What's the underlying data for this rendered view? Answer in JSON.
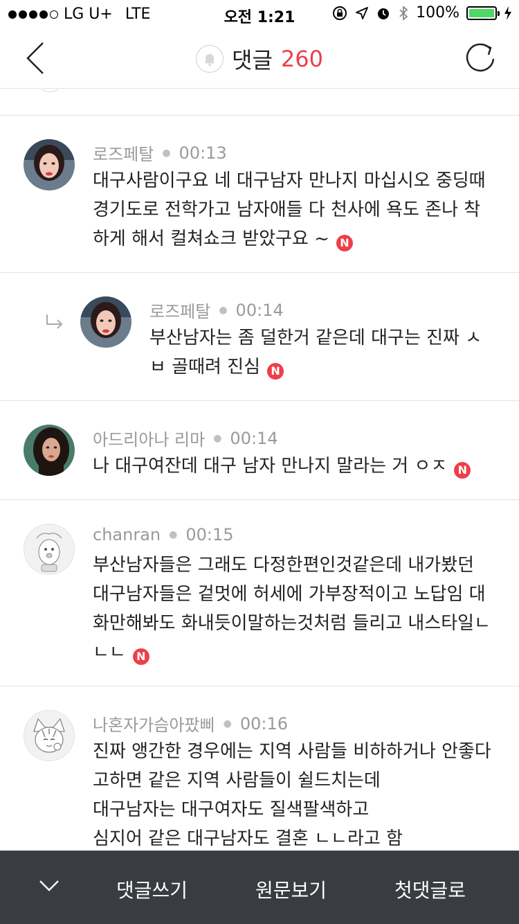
{
  "status": {
    "carrier": "LG U+",
    "network": "LTE",
    "time": "오전 1:21",
    "battery": "100%",
    "battery_level": 1.0,
    "battery_color": "#4cd964"
  },
  "header": {
    "title": "댓글",
    "count": "260",
    "count_color": "#ef3e4a",
    "back_icon": "chevron-left-icon",
    "refresh_icon": "refresh-icon",
    "bell_icon": "bell-icon"
  },
  "comments": [
    {
      "author": "로즈페탈",
      "time": "00:13",
      "text": "대구사람이구요 네 대구남자 만나지 마십시오 중딩때\n경기도로 전학가고 남자애들 다 천사에 욕도 존나 착\n하게 해서 컬쳐쇼크 받았구요 ~",
      "badge": "N",
      "reply": false
    },
    {
      "author": "로즈페탈",
      "time": "00:14",
      "text": "부산남자는 좀 덜한거 같은데 대구는 진짜 ㅅ\nㅂ 골때려 진심",
      "badge": "N",
      "reply": true
    },
    {
      "author": "아드리아나 리마",
      "time": "00:14",
      "text": "나 대구여잔데 대구 남자 만나지 말라는 거 ㅇㅈ",
      "badge": "N",
      "reply": false
    },
    {
      "author": "chanran",
      "time": "00:15",
      "text": "부산남자들은 그래도 다정한편인것같은데 내가봤던\n대구남자들은 겉멋에 허세에 가부장적이고 노답임 대\n화만해봐도 화내듯이말하는것처럼 들리고 내스타일ㄴ\nㄴㄴ",
      "badge": "N",
      "reply": false
    },
    {
      "author": "나혼자가슴아팠삐",
      "time": "00:16",
      "text": "진짜 앵간한 경우에는 지역 사람들 비하하거나 안좋다\n고하면 같은 지역 사람들이 쉴드치는데\n대구남자는 대구여자도 질색팔색하고\n심지어 같은 대구남자도 결혼 ㄴㄴ라고 함",
      "badge": "",
      "reply": false
    }
  ],
  "bottom_bar": {
    "collapse_icon": "chevron-down-icon",
    "write": "댓글쓰기",
    "original": "원문보기",
    "first": "첫댓글로"
  }
}
